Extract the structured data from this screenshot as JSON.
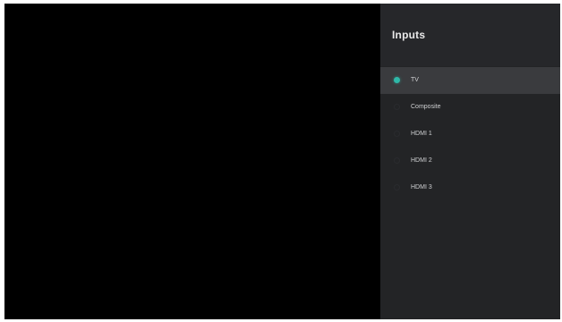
{
  "panel": {
    "title": "Inputs"
  },
  "inputs": [
    {
      "label": "TV",
      "selected": true
    },
    {
      "label": "Composite",
      "selected": false
    },
    {
      "label": "HDMI 1",
      "selected": false
    },
    {
      "label": "HDMI 2",
      "selected": false
    },
    {
      "label": "HDMI 3",
      "selected": false
    }
  ],
  "colors": {
    "panel_background": "#232426",
    "selected_row": "#3a3b3e",
    "accent": "#2fb8a8"
  },
  "icons": {
    "selection_indicator": "radio-dot-icon"
  }
}
